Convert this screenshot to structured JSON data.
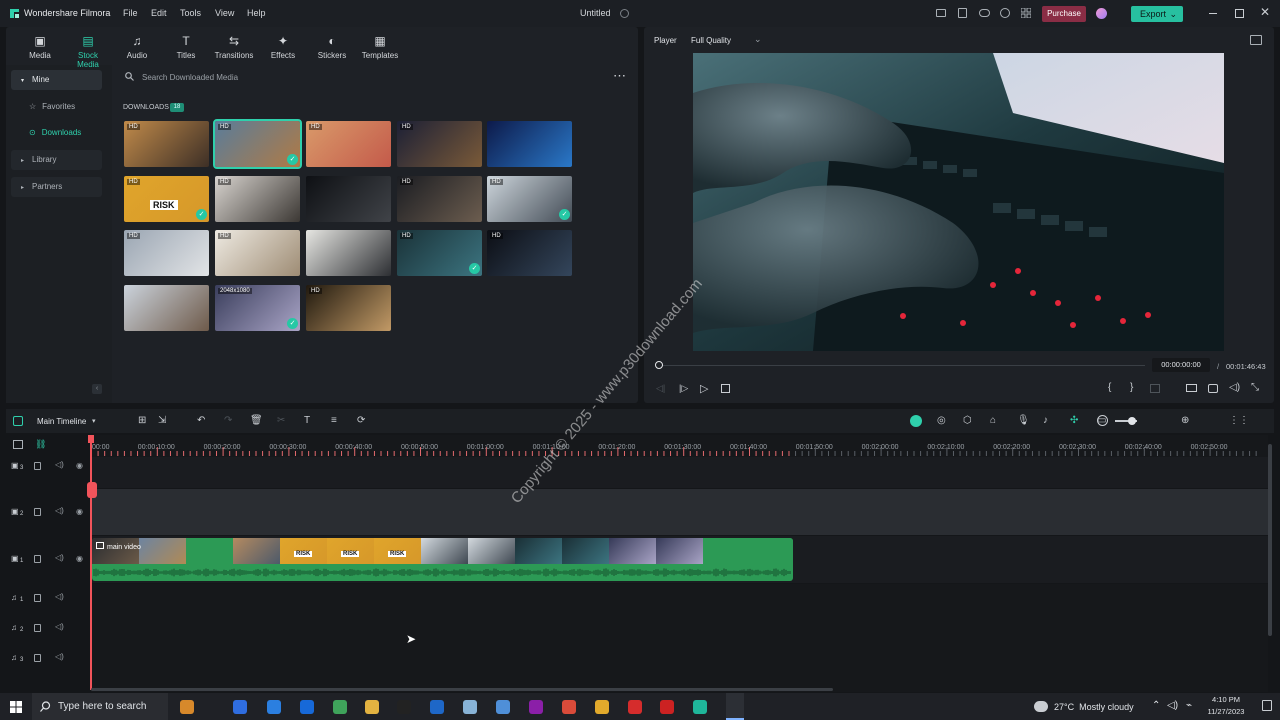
{
  "app": {
    "title": "Wondershare Filmora",
    "doc_title": "Untitled"
  },
  "menu": [
    "File",
    "Edit",
    "Tools",
    "View",
    "Help"
  ],
  "header": {
    "purchase": "Purchase",
    "export": "Export"
  },
  "toolbar": [
    {
      "label": "Media",
      "icon": "media-icon"
    },
    {
      "label": "Stock Media",
      "icon": "stock-media-icon"
    },
    {
      "label": "Audio",
      "icon": "music-note-icon"
    },
    {
      "label": "Titles",
      "icon": "text-icon"
    },
    {
      "label": "Transitions",
      "icon": "transitions-icon"
    },
    {
      "label": "Effects",
      "icon": "effects-icon"
    },
    {
      "label": "Stickers",
      "icon": "stickers-icon"
    },
    {
      "label": "Templates",
      "icon": "templates-icon"
    }
  ],
  "sidebar": {
    "mine": "Mine",
    "items": [
      "Favorites",
      "Downloads",
      "Library",
      "Partners"
    ]
  },
  "search": {
    "placeholder": "Search Downloaded Media"
  },
  "downloads": {
    "label": "DOWNLOADS",
    "count": "18"
  },
  "thumbs": [
    {
      "badge": "HD",
      "checked": false,
      "c1": "#c08a4a",
      "c2": "#3d2f26"
    },
    {
      "badge": "HD",
      "checked": true,
      "c1": "#5a7d9a",
      "c2": "#b07a45"
    },
    {
      "badge": "HD",
      "checked": false,
      "c1": "#d99a6a",
      "c2": "#c45a4a"
    },
    {
      "badge": "HD",
      "checked": false,
      "c1": "#1c2036",
      "c2": "#7a5a38"
    },
    {
      "badge": "",
      "checked": false,
      "c1": "#0d1a4a",
      "c2": "#2a78c8"
    },
    {
      "badge": "HD",
      "checked": true,
      "c1": "#e0a52b",
      "c2": "#d6982a",
      "text": "RISK"
    },
    {
      "badge": "HD",
      "checked": false,
      "c1": "#d8d4cf",
      "c2": "#3c3834"
    },
    {
      "badge": "",
      "checked": false,
      "c1": "#0e1014",
      "c2": "#404348"
    },
    {
      "badge": "HD",
      "checked": false,
      "c1": "#1b1d22",
      "c2": "#6c5d4f"
    },
    {
      "badge": "HD",
      "checked": true,
      "c1": "#cdd5db",
      "c2": "#434c56"
    },
    {
      "badge": "HD",
      "checked": false,
      "c1": "#9ba6b3",
      "c2": "#e2e4e6"
    },
    {
      "badge": "HD",
      "checked": false,
      "c1": "#eeeae2",
      "c2": "#9e8c74"
    },
    {
      "badge": "",
      "checked": false,
      "c1": "#e6e6e2",
      "c2": "#2d2f33"
    },
    {
      "badge": "HD",
      "checked": true,
      "c1": "#1a3238",
      "c2": "#3c7480"
    },
    {
      "badge": "HD",
      "checked": false,
      "c1": "#0c0e14",
      "c2": "#34465c"
    },
    {
      "badge": "",
      "checked": false,
      "c1": "#cbd3dc",
      "c2": "#6e5a4a"
    },
    {
      "badge": "2048x1080",
      "checked": true,
      "c1": "#3a3e5c",
      "c2": "#a9a4c6"
    },
    {
      "badge": "HD",
      "checked": false,
      "c1": "#20190f",
      "c2": "#c29a66"
    }
  ],
  "player": {
    "label": "Player",
    "quality": "Full Quality",
    "time_current": "00:00:00:00",
    "time_sep": "/",
    "time_total": "00:01:46:43"
  },
  "timeline": {
    "label": "Main Timeline",
    "ticks": [
      "00:00",
      "00:00:10:00",
      "00:00:20:00",
      "00:00:30:00",
      "00:00:40:00",
      "00:00:50:00",
      "00:01:00:00",
      "00:01:10:00",
      "00:01:20:00",
      "00:01:30:00",
      "00:01:40:00",
      "00:01:50:00",
      "00:02:00:00",
      "00:02:10:00",
      "00:02:20:00",
      "00:02:30:00",
      "00:02:40:00",
      "00:02:50:00"
    ],
    "clip_label": "main video",
    "tracks": [
      "3",
      "2",
      "1",
      "1",
      "2",
      "3"
    ]
  },
  "watermark": "Copyright © 2025 - www.p30download.com",
  "taskbar": {
    "search": "Type here to search",
    "weather": "27°C  Mostly cloudy",
    "time": "4:10 PM",
    "date": "11/27/2023"
  }
}
